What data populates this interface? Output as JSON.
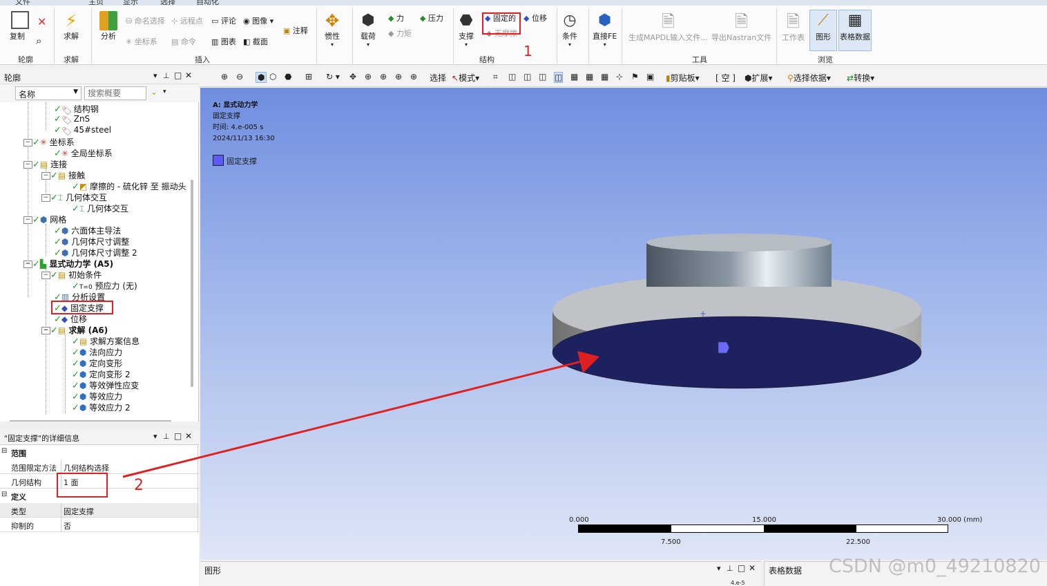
{
  "ribbon": {
    "tabs": [
      "文件",
      "主页",
      "显示",
      "选择",
      "自动化"
    ],
    "outline_group": {
      "copy": "复制",
      "label": "轮廓"
    },
    "solve_group": {
      "solve": "求解",
      "label": "求解"
    },
    "insert_group": {
      "analysis": "分析",
      "named_selection": "命名选择",
      "remote_point": "远程点",
      "comment": "评论",
      "image": "图像",
      "annotation": "注释",
      "coordinate_system": "坐标系",
      "command": "命令",
      "chart": "图表",
      "section": "截面",
      "label": "插入"
    },
    "structure_group": {
      "inertia": "惯性",
      "loads": "载荷",
      "force": "力",
      "pressure": "压力",
      "moment": "力矩",
      "supports": "支撑",
      "fixed": "固定的",
      "displacement": "位移",
      "frictionless": "无摩擦",
      "conditions": "条件",
      "direct_fe": "直接FE",
      "label": "结构"
    },
    "tools_group": {
      "gen_mapdl": "生成MAPDL输入文件...",
      "export_nastran": "导出Nastran文件",
      "label": "工具"
    },
    "browse_group": {
      "worksheet": "工作表",
      "graph": "图形",
      "tabular": "表格数据",
      "label": "浏览"
    },
    "annotation_1": "1"
  },
  "toolbar": {
    "select": "选择",
    "mode": "模式",
    "clipboard": "剪贴板",
    "empty": "[ 空 ]",
    "extend": "扩展",
    "select_by": "选择依据",
    "convert": "转换"
  },
  "outline": {
    "title": "轮廓",
    "filter_name": "名称",
    "search_placeholder": "搜索概要",
    "items": [
      {
        "label": "结构钢"
      },
      {
        "label": "ZnS"
      },
      {
        "label": "45#steel"
      },
      {
        "label": "坐标系"
      },
      {
        "label": "全局坐标系"
      },
      {
        "label": "连接"
      },
      {
        "label": "接触"
      },
      {
        "label": "摩擦的 - 硫化锌 至 振动头"
      },
      {
        "label": "几何体交互"
      },
      {
        "label": "几何体交互"
      },
      {
        "label": "网格"
      },
      {
        "label": "六面体主导法"
      },
      {
        "label": "几何体尺寸调整"
      },
      {
        "label": "几何体尺寸调整 2"
      },
      {
        "label": "显式动力学 (A5)"
      },
      {
        "label": "初始条件"
      },
      {
        "label": "预应力 (无)"
      },
      {
        "label": "分析设置"
      },
      {
        "label": "固定支撑"
      },
      {
        "label": "位移"
      },
      {
        "label": "求解 (A6)"
      },
      {
        "label": "求解方案信息"
      },
      {
        "label": "法向应力"
      },
      {
        "label": "定向变形"
      },
      {
        "label": "定向变形 2"
      },
      {
        "label": "等效弹性应变"
      },
      {
        "label": "等效应力"
      },
      {
        "label": "等效应力 2"
      }
    ]
  },
  "details": {
    "title": "\"固定支撑\"的详细信息",
    "scope_section": "范围",
    "scoping_method_key": "范围限定方法",
    "scoping_method_val": "几何结构选择",
    "geometry_key": "几何结构",
    "geometry_val": "1 面",
    "definition_section": "定义",
    "type_key": "类型",
    "type_val": "固定支撑",
    "suppressed_key": "抑制的",
    "suppressed_val": "否",
    "annotation_2": "2"
  },
  "viewport": {
    "analysis": "A: 显式动力学",
    "object": "固定支撑",
    "time": "时间: 4.e-005 s",
    "date": "2024/11/13 16:30",
    "legend": "固定支撑",
    "legend_color": "#5a5aff",
    "scale": {
      "t0": "0.000",
      "t1": "15.000",
      "t2": "30.000 (mm)",
      "b1": "7.500",
      "b2": "22.500"
    }
  },
  "bottom": {
    "graph_title": "图形",
    "table_title": "表格数据",
    "graph_value": "4.e-5"
  },
  "watermark": "CSDN @m0_49210820"
}
